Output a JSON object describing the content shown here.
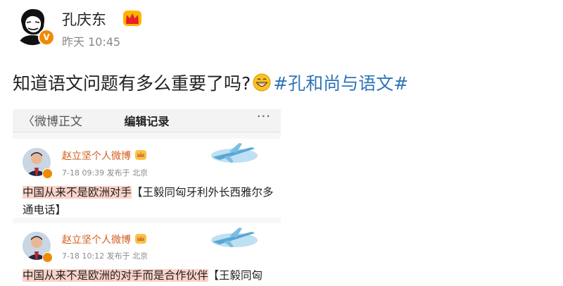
{
  "post": {
    "author": "孔庆东",
    "time": "昨天 10:45",
    "text": "知道语文问题有多么重要了吗?",
    "hashtag": "#孔和尚与语文#",
    "avatar_badge": "V",
    "icons": {
      "crown": "crown-icon",
      "emoji": "grin-emoji-icon",
      "verified": "verified-badge-icon"
    }
  },
  "screenshot": {
    "back_label": "〈微博正文",
    "title": "编辑记录",
    "more": "···",
    "cards": [
      {
        "name": "赵立坚个人微博",
        "meta": "7-18 09:39  发布于 北京",
        "highlight": "中国从来不是欧洲对手",
        "rest": "【王毅同匈牙利外长西雅尔多通电话】"
      },
      {
        "name": "赵立坚个人微博",
        "meta": "7-18 10:12  发布于 北京",
        "highlight": "中国从来不是欧洲的对手而是合作伙伴",
        "rest": "【王毅同匈"
      }
    ]
  },
  "colors": {
    "hashtag": "#2f74b8",
    "name": "#d45a17",
    "highlight": "#fbd3c8",
    "badge": "#f08a00"
  }
}
